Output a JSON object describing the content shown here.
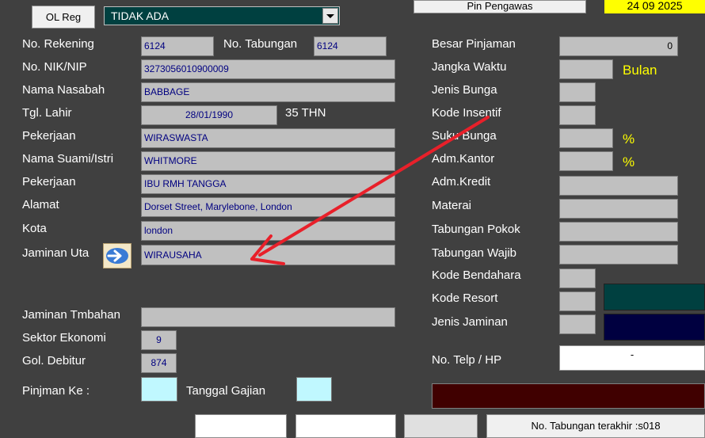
{
  "top": {
    "ol_reg_label": "OL Reg",
    "status_select": "TIDAK ADA",
    "pin_label": "Pin Pengawas",
    "date": "24 09 2025"
  },
  "left": {
    "no_rekening_label": "No. Rekening",
    "no_rekening": "6124",
    "no_tabungan_label": "No. Tabungan",
    "no_tabungan": "6124",
    "nik_label": "No. NIK/NIP",
    "nik": "3273056010900009",
    "nama_label": "Nama Nasabah",
    "nama": "BABBAGE",
    "tgl_lahir_label": "Tgl. Lahir",
    "tgl_lahir": "28/01/1990",
    "umur": "35 THN",
    "pekerjaan_label": "Pekerjaan",
    "pekerjaan": "WIRASWASTA",
    "suami_label": "Nama Suami/Istri",
    "suami": "WHITMORE",
    "pekerjaan2_label": "Pekerjaan",
    "pekerjaan2": "IBU RMH TANGGA",
    "alamat_label": "Alamat",
    "alamat": "Dorset Street, Marylebone, London",
    "kota_label": "Kota",
    "kota": "london",
    "jaminan_label": "Jaminan Uta",
    "jaminan": "WIRAUSAHA",
    "jaminan_tambahan_label": "Jaminan Tmbahan",
    "jaminan_tambahan": "",
    "sektor_label": "Sektor Ekonomi",
    "sektor": "9",
    "gol_label": "Gol. Debitur",
    "gol": "874",
    "pinjaman_ke_label": "Pinjman Ke :",
    "tanggal_gajian_label": "Tanggal Gajian"
  },
  "right": {
    "besar_pinjaman_label": "Besar Pinjaman",
    "besar_pinjaman": "0",
    "jangka_label": "Jangka Waktu",
    "bulan": "Bulan",
    "jenis_bunga_label": "Jenis Bunga",
    "kode_insentif_label": "Kode Insentif",
    "suku_bunga_label": "Suku Bunga",
    "pct": "%",
    "adm_kantor_label": "Adm.Kantor",
    "adm_kredit_label": "Adm.Kredit",
    "materai_label": "Materai",
    "tab_pokok_label": "Tabungan Pokok",
    "tab_wajib_label": "Tabungan Wajib",
    "kode_bendahara_label": "Kode Bendahara",
    "kode_resort_label": "Kode Resort",
    "jenis_jaminan_label": "Jenis Jaminan",
    "telp_label": "No. Telp / HP",
    "telp": "-"
  },
  "bottom": {
    "last_tabungan": "No. Tabungan terakhir :s018"
  },
  "colors": {
    "background": "#404040",
    "field": "#c0c0c0",
    "field_text": "#000080",
    "accent_yellow": "#ffff00",
    "resort_teal": "#004040",
    "jaminan_navy": "#000040",
    "status_bar": "#400000",
    "annotation_arrow": "#e8202a"
  }
}
